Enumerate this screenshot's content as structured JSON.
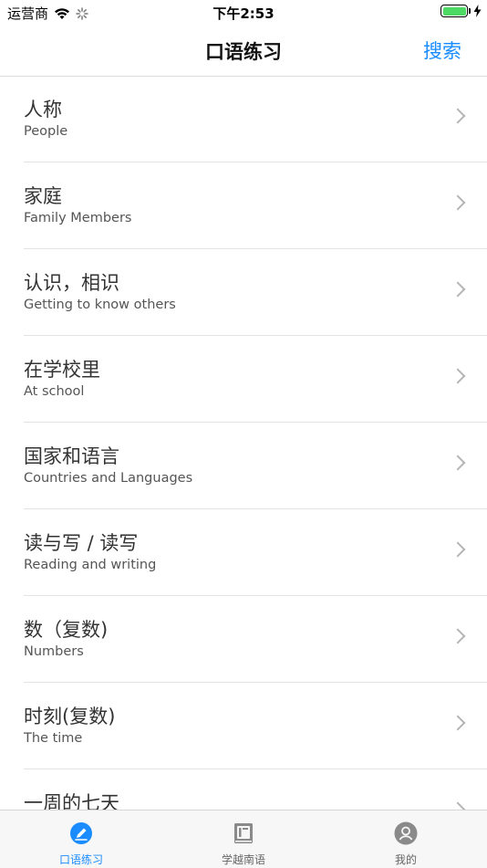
{
  "status_bar": {
    "carrier": "运营商",
    "time": "下午2:53"
  },
  "nav": {
    "title": "口语练习",
    "action_label": "搜索"
  },
  "list": {
    "items": [
      {
        "title": "人称",
        "subtitle": "People"
      },
      {
        "title": "家庭",
        "subtitle": "Family Members"
      },
      {
        "title": "认识，相识",
        "subtitle": "Getting to know others"
      },
      {
        "title": "在学校里",
        "subtitle": "At school"
      },
      {
        "title": "国家和语言",
        "subtitle": "Countries and Languages"
      },
      {
        "title": "读与写 / 读写",
        "subtitle": "Reading and writing"
      },
      {
        "title": "数（复数)",
        "subtitle": "Numbers"
      },
      {
        "title": "时刻(复数)",
        "subtitle": "The time"
      },
      {
        "title": "一周的七天",
        "subtitle": ""
      }
    ]
  },
  "tab_bar": {
    "tabs": [
      {
        "label": "口语练习",
        "icon": "pencil-badge-icon",
        "active": true
      },
      {
        "label": "学越南语",
        "icon": "book-icon",
        "active": false
      },
      {
        "label": "我的",
        "icon": "person-icon",
        "active": false
      }
    ]
  },
  "colors": {
    "accent": "#1a8cff",
    "battery": "#4cd964",
    "separator": "#e3e3e3"
  }
}
